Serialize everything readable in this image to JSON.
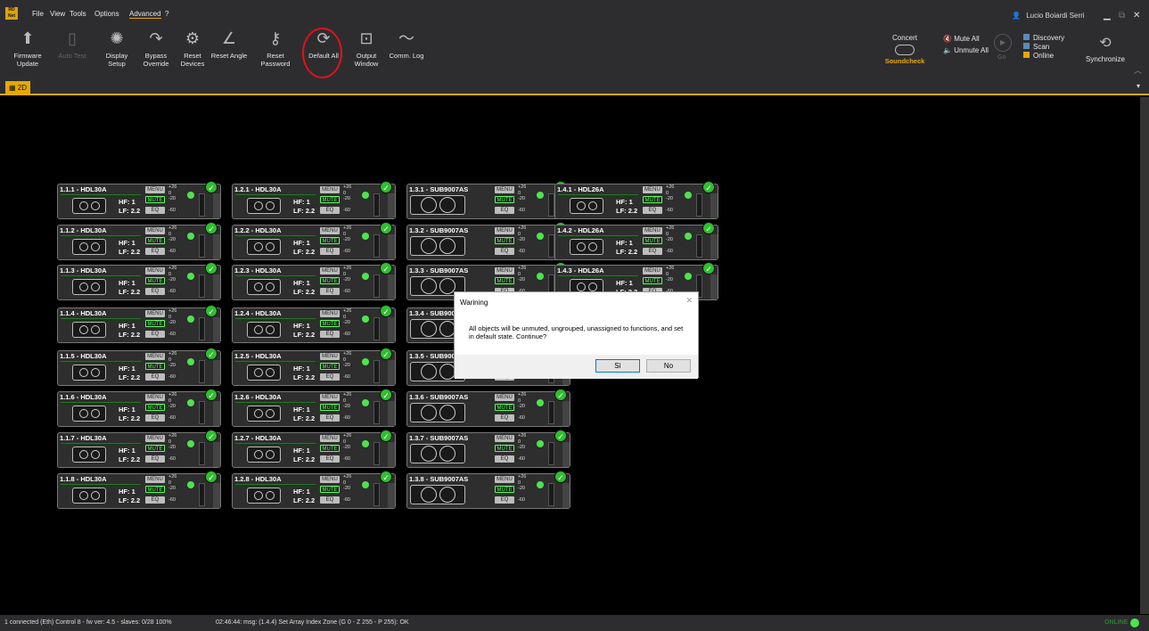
{
  "menubar": {
    "logo_text": "RD Net",
    "items": [
      "File",
      "View",
      "Tools",
      "Options",
      "Advanced",
      "?"
    ],
    "user": "Lucio Boiardi Serri"
  },
  "toolbar": {
    "firmware_update": "Firmware Update",
    "auto_test": "Auto Test",
    "display_setup": "Display Setup",
    "bypass_override": "Bypass Override",
    "reset_devices": "Reset Devices",
    "reset_angle": "Reset Angle",
    "reset_password": "Reset Password",
    "default_all": "Default All",
    "output_window": "Output Window",
    "comm_log": "Comm. Log",
    "concert": "Concert",
    "soundcheck": "Soundcheck",
    "mute_all": "Mute All",
    "unmute_all": "Unmute All",
    "go": "Go",
    "discovery": "Discovery",
    "scan": "Scan",
    "online": "Online",
    "synchronize": "Synchronize"
  },
  "tabs": {
    "active": "2D"
  },
  "devices": [
    [
      "1.1.1 - HDL30A",
      "1.1.2 - HDL30A",
      "1.1.3 - HDL30A",
      "1.1.4 - HDL30A",
      "1.1.5 - HDL30A",
      "1.1.6 - HDL30A",
      "1.1.7 - HDL30A",
      "1.1.8 - HDL30A"
    ],
    [
      "1.2.1 - HDL30A",
      "1.2.2 - HDL30A",
      "1.2.3 - HDL30A",
      "1.2.4 - HDL30A",
      "1.2.5 - HDL30A",
      "1.2.6 - HDL30A",
      "1.2.7 - HDL30A",
      "1.2.8 - HDL30A"
    ],
    [
      "1.3.1 - SUB9007AS",
      "1.3.2 - SUB9007AS",
      "1.3.3 - SUB9007AS",
      "1.3.4 - SUB9007AS",
      "1.3.5 - SUB9007AS",
      "1.3.6 - SUB9007AS",
      "1.3.7 - SUB9007AS",
      "1.3.8 - SUB9007AS"
    ],
    [
      "1.4.1 - HDL26A",
      "1.4.2 - HDL26A",
      "1.4.3 - HDL26A"
    ]
  ],
  "card": {
    "menu": "MENU",
    "mute": "MUTE",
    "eq": "EQ",
    "hf": "HF: 1",
    "lf": "LF: 2.2",
    "scale": [
      "+26",
      "0",
      "-20",
      "-60"
    ]
  },
  "dialog": {
    "title": "Warining",
    "message": "All objects will be unmuted, ungrouped, unassigned to functions, and set in default state. Continue?",
    "yes": "Sì",
    "no": "No"
  },
  "status": {
    "left": "1 connected (Eth) Control 8 - fw ver: 4.5 - slaves: 0/28 100%",
    "msg": "02:46:44: msg: (1.4.4) Set Array Index Zone (G 0 - Z 255 - P 255): OK",
    "online": "ONLINE"
  }
}
